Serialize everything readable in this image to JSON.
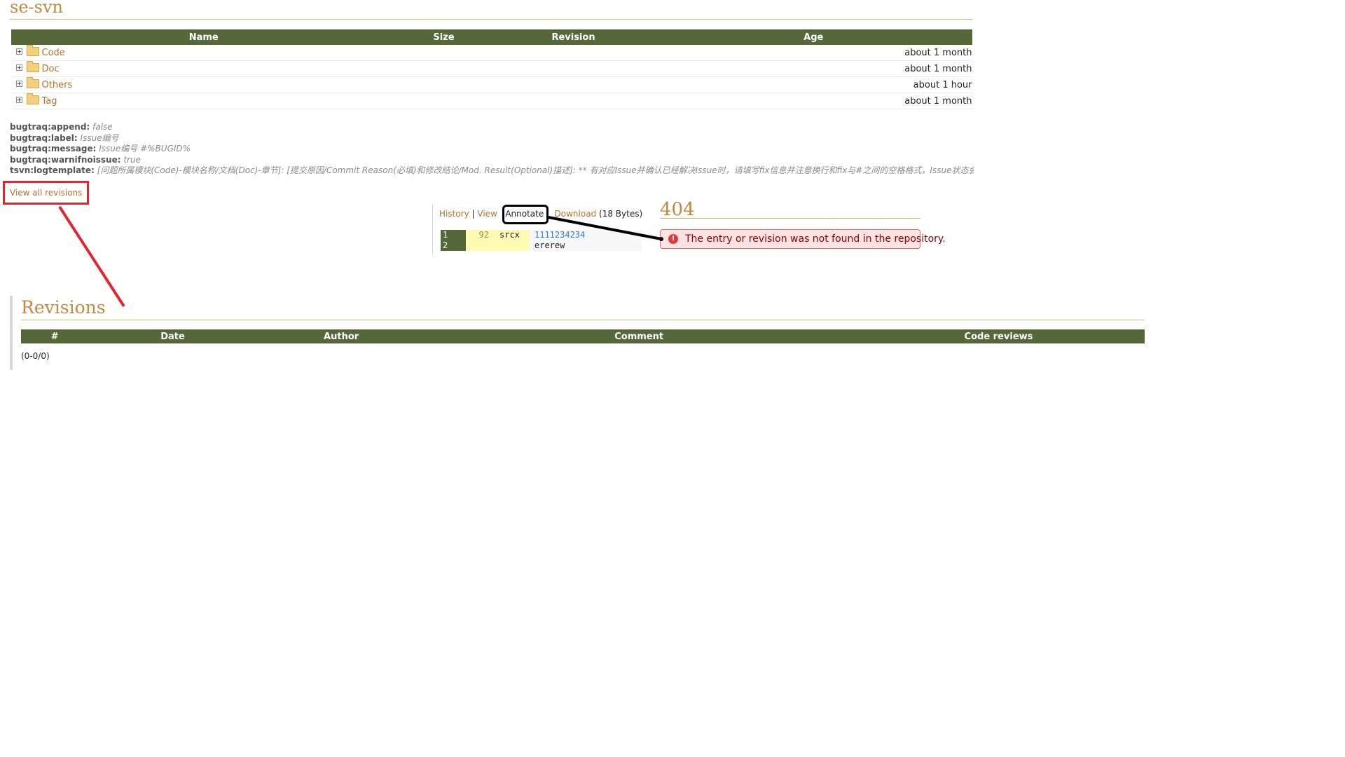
{
  "repository": {
    "title": "se-svn"
  },
  "entries_table": {
    "columns": [
      "Name",
      "Size",
      "Revision",
      "Age"
    ],
    "rows": [
      {
        "name": "Code",
        "size": "",
        "revision": "",
        "age": "about 1 month"
      },
      {
        "name": "Doc",
        "size": "",
        "revision": "",
        "age": "about 1 month"
      },
      {
        "name": "Others",
        "size": "",
        "revision": "",
        "age": "about 1 hour"
      },
      {
        "name": "Tag",
        "size": "",
        "revision": "",
        "age": "about 1 month"
      }
    ]
  },
  "properties": [
    {
      "name": "bugtraq:append:",
      "value": "false"
    },
    {
      "name": "bugtraq:label:",
      "value": "Issue编号"
    },
    {
      "name": "bugtraq:message:",
      "value": "Issue编号 #%BUGID%"
    },
    {
      "name": "bugtraq:warnifnoissue:",
      "value": "true"
    },
    {
      "name": "tsvn:logtemplate:",
      "value": "[问题所属模块(Code)-模块名称/文档(Doc)-章节]: [提交原因/Commit Reason(必填)和修改结论/Mod. Result(Optional)描述]: ** 有对应Issue并确认已经解决Issue时，请填写fix信息并注意换行和fix与#之间的空格格式，Issue状态会自动"
    }
  ],
  "view_all_revisions_link": "View all revisions",
  "file_panel": {
    "links": {
      "history": "History",
      "separator": "|",
      "view": "View",
      "annotate": "Annotate",
      "download": "Download",
      "size": "(18 Bytes)"
    },
    "annotation_lines": [
      {
        "line": "1",
        "revision": "92",
        "author": "srcx",
        "code": "1111234234"
      },
      {
        "line": "2",
        "revision": "",
        "author": "",
        "code": "ererew"
      }
    ]
  },
  "error": {
    "title": "404",
    "message": "The entry or revision was not found in the repository.",
    "icon": "exclamation-circle-icon"
  },
  "revisions": {
    "title": "Revisions",
    "columns": [
      "#",
      "Date",
      "Author",
      "Comment",
      "Code reviews"
    ],
    "pagination": "(0-0/0)"
  },
  "colors": {
    "table_header": "#56683a",
    "heading": "#c08a3e",
    "link": "#b5722b",
    "callout_red": "#e22630",
    "callout_black": "#000000",
    "error_bg": "#ffe3e3"
  }
}
